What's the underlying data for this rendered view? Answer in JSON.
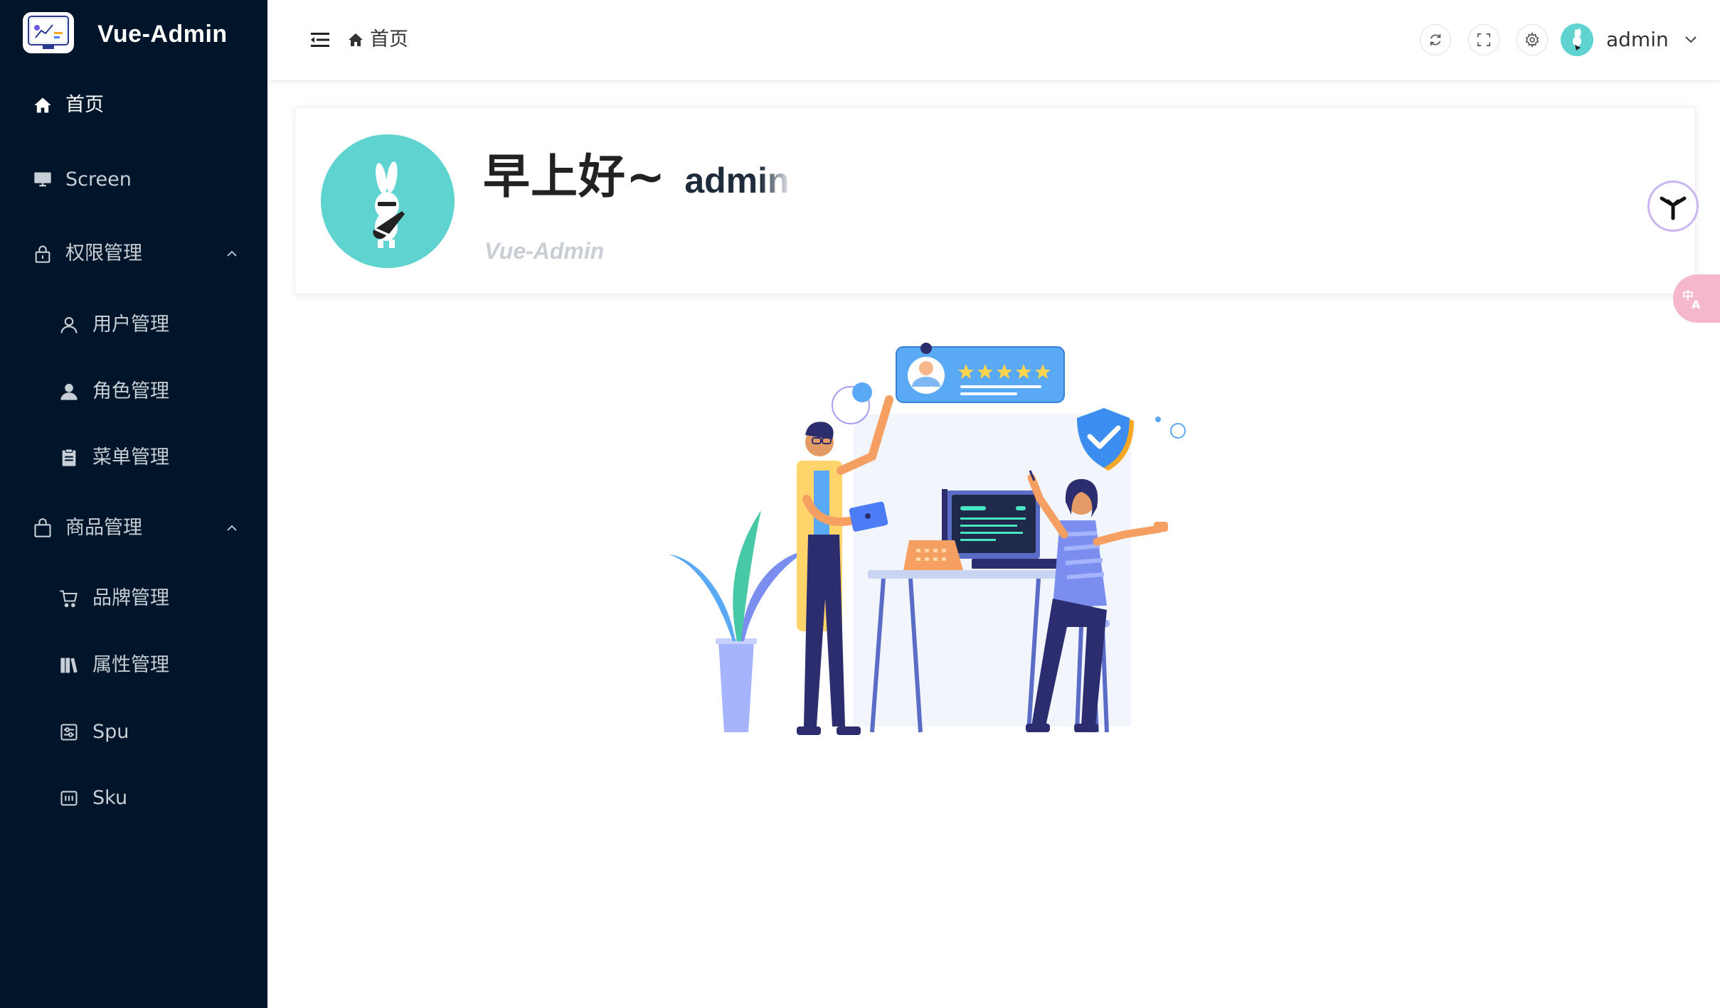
{
  "brand": {
    "title": "Vue-Admin"
  },
  "sidebar": {
    "items": [
      {
        "label": "首页",
        "icon": "home-icon",
        "active": true
      },
      {
        "label": "Screen",
        "icon": "monitor-icon"
      },
      {
        "label": "权限管理",
        "icon": "lock-icon",
        "expanded": true,
        "children": [
          {
            "label": "用户管理",
            "icon": "user-icon"
          },
          {
            "label": "角色管理",
            "icon": "user-filled-icon"
          },
          {
            "label": "菜单管理",
            "icon": "document-icon"
          }
        ]
      },
      {
        "label": "商品管理",
        "icon": "shopping-bag-icon",
        "expanded": true,
        "children": [
          {
            "label": "品牌管理",
            "icon": "cart-icon"
          },
          {
            "label": "属性管理",
            "icon": "collection-icon"
          },
          {
            "label": "Spu",
            "icon": "sliders-icon"
          },
          {
            "label": "Sku",
            "icon": "sku-icon"
          }
        ]
      }
    ]
  },
  "header": {
    "breadcrumb": {
      "label": "首页",
      "icon": "home-icon"
    },
    "buttons": [
      "refresh-icon",
      "fullscreen-icon",
      "settings-icon"
    ],
    "user": {
      "name": "admin"
    }
  },
  "main": {
    "greeting": "早上好~",
    "username": "admin",
    "subtitle": "Vue-Admin"
  },
  "colors": {
    "sidebar_bg": "#001529",
    "avatar_bg": "#5fd3d0",
    "accent_blue": "#4d7cf7",
    "illustration_blue": "#5aa9f5"
  }
}
